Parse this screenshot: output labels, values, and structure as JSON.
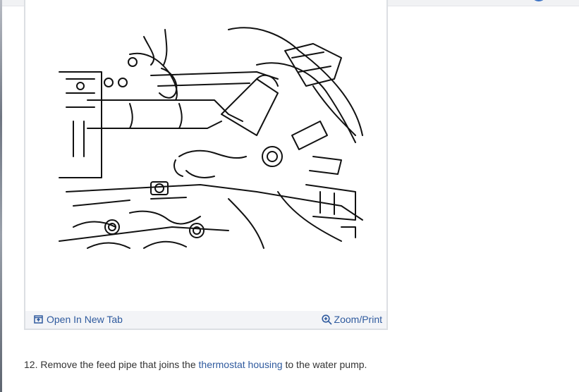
{
  "figure": {
    "open_tab_label": "Open In New Tab",
    "zoom_label": "Zoom/Print"
  },
  "instruction": {
    "number": "12.",
    "text_before": "Remove the feed pipe that joins the",
    "link_text": "thermostat housing",
    "text_after": "to the water pump."
  },
  "icons": {
    "open_tab": "open-new-tab-icon",
    "zoom": "zoom-in-icon"
  },
  "colors": {
    "link": "#2f5a9e",
    "footer_bg": "#f3f4f7",
    "panel_border": "#dcdfe3",
    "accent": "#3f74c4"
  }
}
